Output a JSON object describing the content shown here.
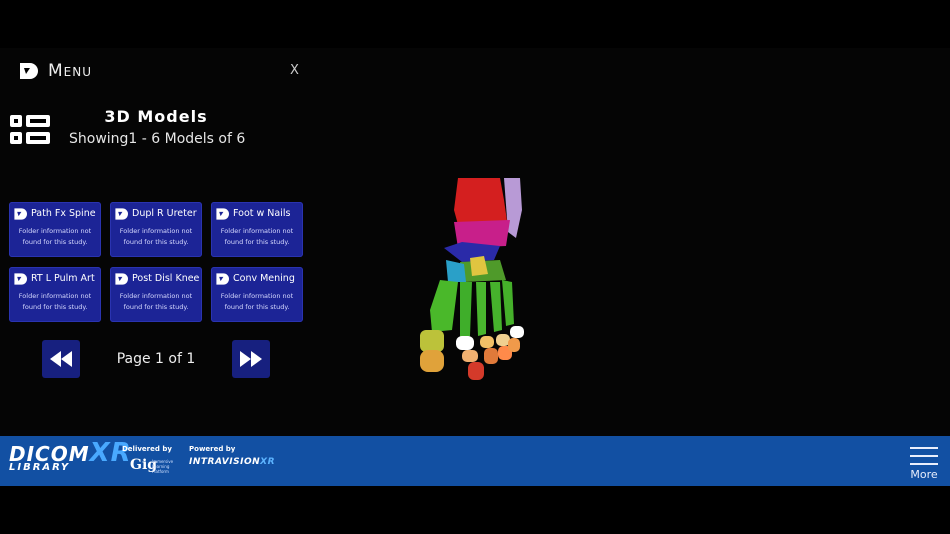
{
  "menu": {
    "title": "Menu",
    "close": "X"
  },
  "models": {
    "title": "3D Models",
    "subtitle": "Showing1 - 6 Models of 6"
  },
  "cards": [
    {
      "name": "Path Fx Spine",
      "info": "Folder information not found for this study."
    },
    {
      "name": "Dupl R Ureter",
      "info": "Folder information not found for this study."
    },
    {
      "name": "Foot w Nails",
      "info": "Folder information not found for this study."
    },
    {
      "name": "RT L Pulm Art",
      "info": "Folder information not found for this study."
    },
    {
      "name": "Post Disl Knee",
      "info": "Folder information not found for this study."
    },
    {
      "name": "Conv Mening",
      "info": "Folder information not found for this study."
    }
  ],
  "pagination": {
    "label": "Page 1 of 1",
    "prev_icon": "rewind-icon",
    "next_icon": "fast-forward-icon"
  },
  "viewer": {
    "model": "foot-skeleton-3d-model"
  },
  "footer": {
    "brand_main": "DICOM",
    "brand_xr": "XR",
    "brand_sub": "LIBRARY",
    "delivered_by": "Delivered by",
    "gig": "Gig",
    "gig_sub": "Immersive Learning Platform",
    "powered_by": "Powered by",
    "intravision": "INTRAVISION",
    "intravision_xr": "XR",
    "more": "More"
  },
  "colors": {
    "card_bg": "#1c2496",
    "footer_bg": "#1250a3",
    "pager_bg": "#17207f"
  }
}
